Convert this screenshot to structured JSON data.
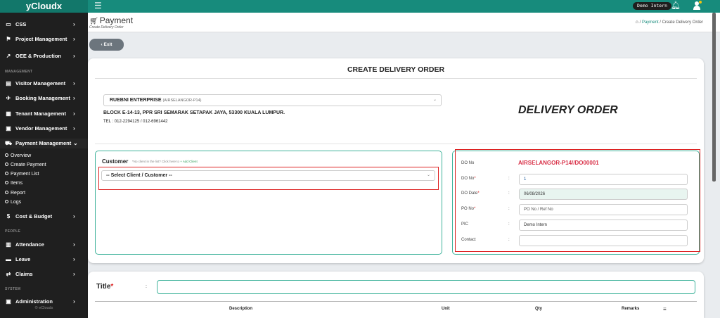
{
  "app": {
    "brand": "yCloudx"
  },
  "topbar": {
    "user_label": "Demo Intern"
  },
  "sidebar": {
    "top_items": [
      {
        "label": "CSS",
        "icon": "monitor-icon"
      },
      {
        "label": "Project Management",
        "icon": "flag-icon"
      },
      {
        "label": "OEE & Production",
        "icon": "chart-line-icon"
      }
    ],
    "section_management": "MANAGEMENT",
    "management_items": [
      {
        "label": "Visitor Management",
        "icon": "id-card-icon"
      },
      {
        "label": "Booking Management",
        "icon": "plane-icon"
      },
      {
        "label": "Tenant Management",
        "icon": "building-icon"
      },
      {
        "label": "Vendor Management",
        "icon": "address-card-icon"
      },
      {
        "label": "Payment Management",
        "icon": "cart-icon"
      }
    ],
    "payment_sub": [
      "Overview",
      "Create Payment",
      "Payment List",
      "Items",
      "Report",
      "Logs"
    ],
    "cost_budget": "Cost & Budget",
    "section_people": "PEOPLE",
    "people_items": [
      {
        "label": "Attendance",
        "icon": "calendar-icon"
      },
      {
        "label": "Leave",
        "icon": "briefcase-icon"
      },
      {
        "label": "Claims",
        "icon": "exchange-icon"
      }
    ],
    "section_system": "SYSTEM",
    "system_items": [
      {
        "label": "Administration",
        "icon": "admin-icon"
      }
    ],
    "footer": "© eClouds"
  },
  "header": {
    "title": "Payment",
    "subtitle": "Create Delivery Order",
    "breadcrumb": [
      "Payment",
      "Create Delivery Order"
    ]
  },
  "exit_label": "Exit",
  "form": {
    "heading": "CREATE DELIVERY ORDER",
    "company_name": "RUEBNI ENTERPRISE",
    "company_code": "(AIRSELANGOR-P14)",
    "address": "BLOCK E-14-13, PPR SRI SEMARAK SETAPAK JAYA, 53300 KUALA LUMPUR.",
    "tel": "TEL : 012-2294125 / 012-6961442",
    "doc_title": "DELIVERY ORDER",
    "customer_label": "Customer",
    "customer_note": "*No client in the list? Click here to",
    "add_client": "+ Add Client",
    "customer_placeholder": "-- Select Client / Customer --",
    "do_fields": {
      "do_no_label": "DO No",
      "do_no_value": "AIRSELANGOR-P14//DO00001",
      "do_no2_label": "DO No",
      "do_no2_value": "1",
      "do_date_label": "DO Date",
      "do_date_value": "06/08/2026",
      "po_no_label": "PO No",
      "po_no_placeholder": "PO No / Ref No",
      "pic_label": "PIC",
      "pic_value": "Demo Intern",
      "contact_label": "Contact",
      "contact_value": ""
    }
  },
  "items": {
    "title_label": "Title",
    "title_value": "",
    "columns": [
      "Description",
      "Unit",
      "Qty",
      "Remarks"
    ]
  },
  "colors": {
    "brand": "#178b7c",
    "accent_red": "#d9334a",
    "border_green": "#3fb39b"
  }
}
